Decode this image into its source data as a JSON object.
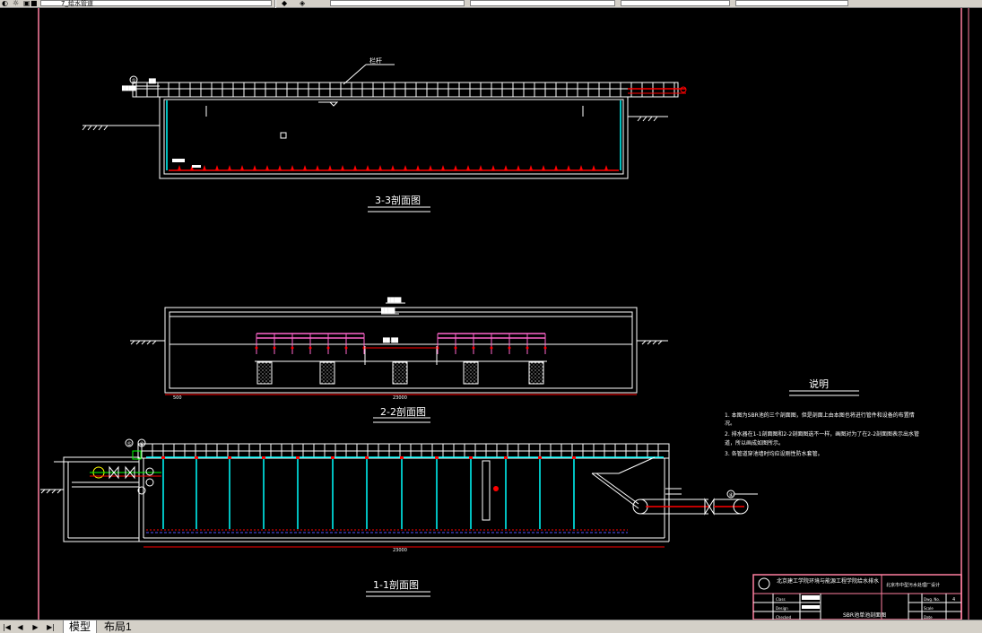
{
  "toolbar": {
    "layer_value": "7_给水管道",
    "fields": [
      "",
      "",
      "",
      ""
    ]
  },
  "drawing": {
    "section_3_3_title": "3-3剖面图",
    "section_2_2_title": "2-2剖面图",
    "section_1_1_title": "1-1剖面图",
    "label_railing": "栏杆",
    "dim_1_1_length": "23000",
    "dim_2_2_length": "23000",
    "dim_2_2_left": "500",
    "notes_title": "说明",
    "notes": [
      "1. 本图为SBR池的三个剖面图，但是剖面上由本图也将进行管件和设备的布置情",
      "况。",
      "2. 排水器在1-1剖面图和2-2剖面图选不一样，画图对为了在2-2剖面图表示出水管",
      "道，所以画成如图所示。",
      "3. 各管道穿池墙时均应设刚性防水套管。"
    ],
    "circle_labels": [
      "①",
      "⑤",
      "⑥",
      "④"
    ],
    "title_block": {
      "org": "北京建工学院环境与能源工程学院给水排水",
      "project": "北京市中型污水处理厂设计",
      "drawing_name": "SBR池单池剖面图",
      "rows": [
        "Class",
        "Design",
        "Checked"
      ],
      "right_rows": [
        "Dwg. No.",
        "Scale",
        "Date"
      ],
      "value_no": "4"
    }
  },
  "statusbar": {
    "nav": [
      "|◀",
      "◀",
      "▶",
      "▶|"
    ],
    "tabs": [
      "模型",
      "布局1"
    ]
  },
  "colors": {
    "background": "#000000",
    "line_white": "#ffffff",
    "frame_pink": "#ff7f9f",
    "pipe_red": "#ff0000",
    "riser_cyan": "#00ffff",
    "rail_magenta": "#ff66cc",
    "support_green": "#00ff00"
  }
}
